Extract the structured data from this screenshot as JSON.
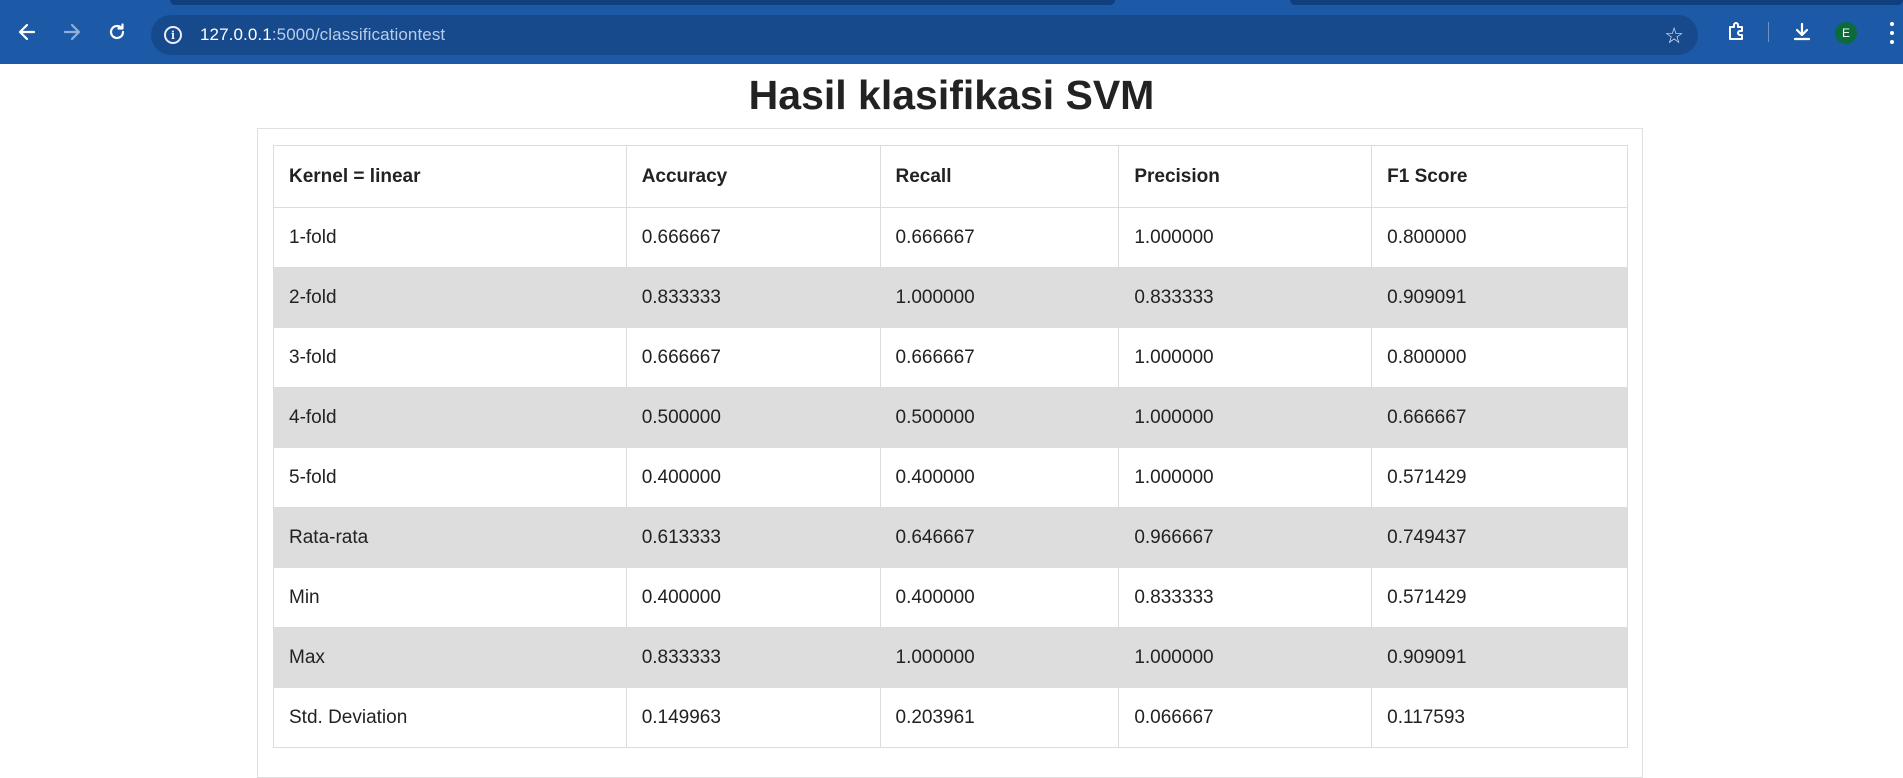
{
  "browser": {
    "url_host": "127.0.0.1",
    "url_rest": ":5000/classificationtest",
    "avatar_letter": "E"
  },
  "page": {
    "title": "Hasil klasifikasi SVM"
  },
  "table": {
    "headers": [
      "Kernel = linear",
      "Accuracy",
      "Recall",
      "Precision",
      "F1 Score"
    ],
    "rows": [
      [
        "1-fold",
        "0.666667",
        "0.666667",
        "1.000000",
        "0.800000"
      ],
      [
        "2-fold",
        "0.833333",
        "1.000000",
        "0.833333",
        "0.909091"
      ],
      [
        "3-fold",
        "0.666667",
        "0.666667",
        "1.000000",
        "0.800000"
      ],
      [
        "4-fold",
        "0.500000",
        "0.500000",
        "1.000000",
        "0.666667"
      ],
      [
        "5-fold",
        "0.400000",
        "0.400000",
        "1.000000",
        "0.571429"
      ],
      [
        "Rata-rata",
        "0.613333",
        "0.646667",
        "0.966667",
        "0.749437"
      ],
      [
        "Min",
        "0.400000",
        "0.400000",
        "0.833333",
        "0.571429"
      ],
      [
        "Max",
        "0.833333",
        "1.000000",
        "1.000000",
        "0.909091"
      ],
      [
        "Std. Deviation",
        "0.149963",
        "0.203961",
        "0.066667",
        "0.117593"
      ]
    ]
  },
  "colors": {
    "chrome": "#1c5aa8",
    "omnibox": "#174a8c",
    "row_stripe": "#dddddd",
    "avatar": "#0b6b3a"
  }
}
